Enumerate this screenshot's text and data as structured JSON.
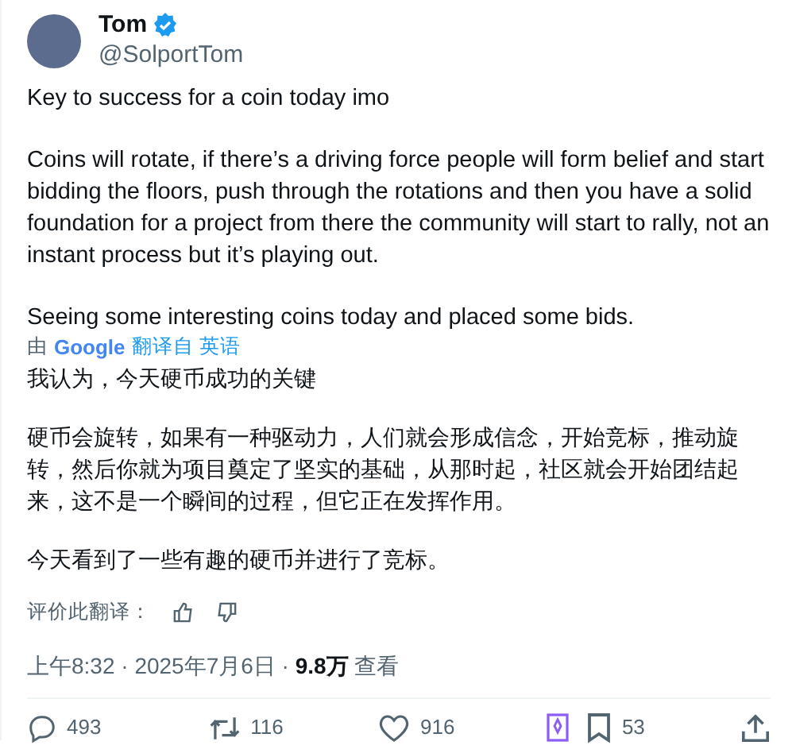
{
  "author": {
    "name": "Tom",
    "verified": true,
    "handle": "@SolportTom"
  },
  "paragraphs": [
    "Key to success for a coin today imo",
    "Coins will rotate, if there’s a driving force people will form belief and start bidding the floors, push through the rotations and then you have a solid foundation for a project from there the community will start to rally, not an instant process but it’s playing out.",
    "Seeing some interesting coins today and placed some bids."
  ],
  "translation": {
    "by": "由",
    "provider": "Google",
    "link": "翻译自 英语",
    "paragraphs": [
      "我认为，今天硬币成功的关键",
      "硬币会旋转，如果有一种驱动力，人们就会形成信念，开始竞标，推动旋转，然后你就为项目奠定了坚实的基础，从那时起，社区就会开始团结起来，这不是一个瞬间的过程，但它正在发挥作用。",
      "今天看到了一些有趣的硬币并进行了竞标。"
    ],
    "rate_label": "评价此翻译："
  },
  "meta": "上午8:32 · 2025年7月6日 · **9.8万** 查看",
  "actions": [
    {
      "kind": "reply",
      "count": "493"
    },
    {
      "kind": "repost",
      "count": "116"
    },
    {
      "kind": "like",
      "count": "916"
    },
    {
      "kind": "extension"
    },
    {
      "kind": "bookmark",
      "count": "53"
    },
    {
      "kind": "share"
    }
  ]
}
